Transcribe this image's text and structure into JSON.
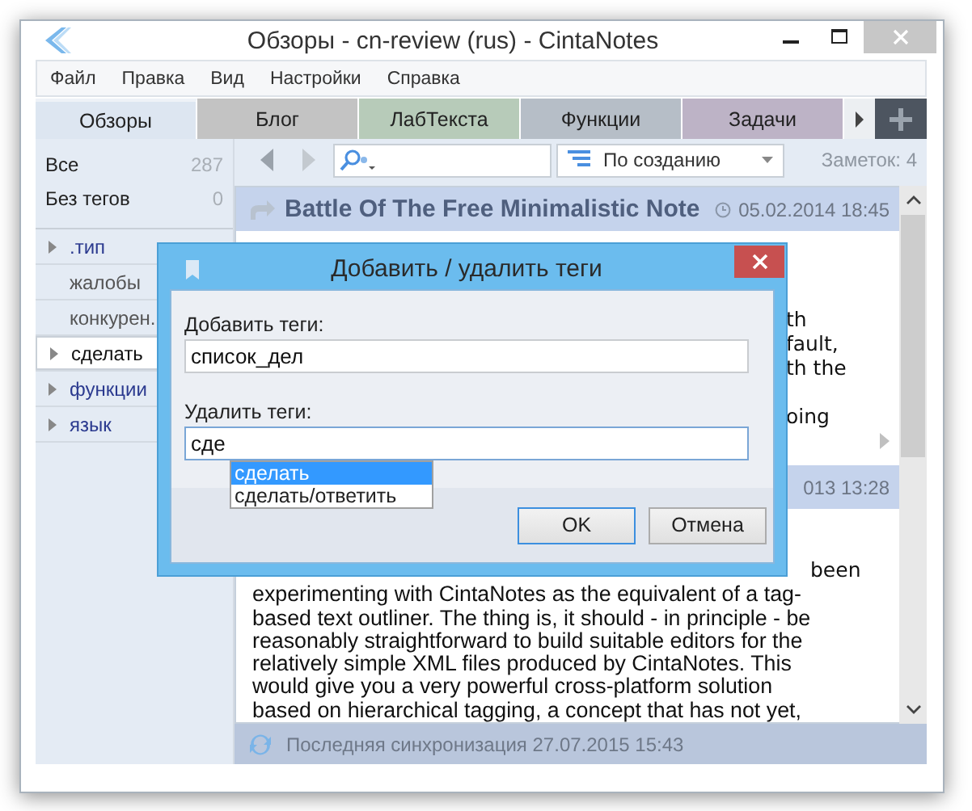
{
  "window": {
    "title": "Обзоры - cn-review (rus) - CintaNotes"
  },
  "menu": [
    "Файл",
    "Правка",
    "Вид",
    "Настройки",
    "Справка"
  ],
  "tabs": [
    {
      "label": "Обзоры",
      "selected": true,
      "color": "#dde6f1"
    },
    {
      "label": "Блог",
      "selected": false,
      "color": "#c3c3c3"
    },
    {
      "label": "ЛабТекста",
      "selected": false,
      "color": "#b7cbb9"
    },
    {
      "label": "Функции",
      "selected": false,
      "color": "#b6bec7"
    },
    {
      "label": "Задачи",
      "selected": false,
      "color": "#bdb3c6"
    }
  ],
  "sidebar": {
    "filters": [
      {
        "label": "Все",
        "count": "287"
      },
      {
        "label": "Без тегов",
        "count": "0"
      }
    ],
    "tags": [
      {
        "label": ".тип",
        "expandable": true,
        "selected": false,
        "color": "#2b3a8f"
      },
      {
        "label": "жалобы",
        "expandable": false,
        "selected": false,
        "color": "#555555"
      },
      {
        "label": "конкурен.",
        "expandable": false,
        "selected": false,
        "color": "#555555"
      },
      {
        "label": "сделать",
        "expandable": true,
        "selected": true,
        "color": "#111111"
      },
      {
        "label": "функции",
        "expandable": true,
        "selected": false,
        "color": "#2b3a8f"
      },
      {
        "label": "язык",
        "expandable": true,
        "selected": false,
        "color": "#2b3a8f"
      }
    ]
  },
  "toolbar": {
    "sort": "По созданию",
    "count": "Заметок: 4"
  },
  "notes": [
    {
      "title": "Battle Of The Free Minimalistic Note",
      "date": "05.02.2014 18:45",
      "fragments": [
        [
          "th",
          "fault,",
          "th the"
        ],
        [
          "oing"
        ]
      ]
    },
    {
      "date": "013 13:28",
      "fragments": [
        [
          "been"
        ]
      ],
      "body": "experimenting with CintaNotes as the equivalent of a tag-\nbased text outliner. The thing is, it should - in principle - be\nreasonably straightforward to build suitable editors for the\nrelatively simple XML files produced by CintaNotes. This\nwould give you a very powerful cross-platform solution\nbased on hierarchical tagging, a concept that has not yet,"
    }
  ],
  "status_bar": {
    "text": "Последняя синхронизация 27.07.2015 15:43"
  },
  "dialog": {
    "title": "Добавить / удалить теги",
    "fields": [
      {
        "label": "Добавить теги:",
        "value": "список_дел",
        "focused": false
      },
      {
        "label": "Удалить теги:",
        "value": "сде",
        "focused": true
      }
    ],
    "suggestions": [
      {
        "label": "сделать",
        "selected": true
      },
      {
        "label": "сделать/ответить",
        "selected": false
      }
    ],
    "buttons": [
      {
        "label": "OK",
        "default": true
      },
      {
        "label": "Отмена",
        "default": false
      }
    ]
  }
}
